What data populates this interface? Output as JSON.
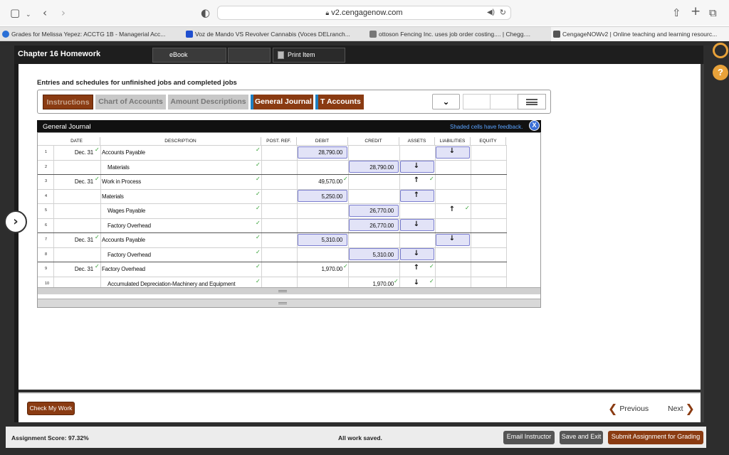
{
  "browser": {
    "url": "v2.cengagenow.com",
    "tabs": [
      {
        "label": "Grades for Melissa Yepez: ACCTG 1B - Managerial Acc...",
        "color": "#2a6fd6"
      },
      {
        "label": "Voz de Mando VS Revolver Cannabis (Voces DELranch...",
        "color": "#1f4fcf"
      },
      {
        "label": "ottoson Fencing Inc. uses job order costing.... | Chegg....",
        "color": "#777777"
      },
      {
        "label": "CengageNOWv2 | Online teaching and learning resourc...",
        "color": "#555555"
      }
    ],
    "icons": [
      "sidebar-icon",
      "back-icon",
      "forward-icon",
      "shield-icon",
      "lock-icon",
      "audio-icon",
      "reload-icon",
      "share-icon",
      "new-tab-icon",
      "tab-overview-icon"
    ]
  },
  "app": {
    "chapter_title": "Chapter 16 Homework",
    "tabs": {
      "ebook": "eBook",
      "blank": "",
      "print": "Print Item"
    },
    "heading": "Entries and schedules for unfinished jobs and completed jobs"
  },
  "toolbar": {
    "instructions": "Instructions",
    "chart_of_accounts": "Chart of Accounts",
    "amount_descriptions": "Amount Descriptions",
    "general_journal": "General Journal",
    "t_accounts": "T Accounts",
    "dropdown_icon": "chevron-down-icon",
    "menu_icon": "menu-icon"
  },
  "journal": {
    "title": "General Journal",
    "feedback_note": "Shaded cells have feedback.",
    "close_label": "X",
    "columns": {
      "date": "DATE",
      "description": "DESCRIPTION",
      "post_ref": "POST. REF.",
      "debit": "DEBIT",
      "credit": "CREDIT",
      "assets": "ASSETS",
      "liabilities": "LIABILITIES",
      "equity": "EQUITY"
    },
    "rows": [
      {
        "n": "1",
        "date": "Dec. 31",
        "desc": "Accounts Payable",
        "indent": false,
        "debit": "28,790.00",
        "credit": "",
        "assets": "",
        "liabilities": "↓"
      },
      {
        "n": "2",
        "date": "",
        "desc": "Materials",
        "indent": true,
        "debit": "",
        "credit": "28,790.00",
        "assets": "↓",
        "liabilities": ""
      },
      {
        "n": "3",
        "date": "Dec. 31",
        "desc": "Work in Process",
        "indent": false,
        "debit": "49,570.00",
        "credit": "",
        "assets": "↑",
        "liabilities": ""
      },
      {
        "n": "4",
        "date": "",
        "desc": "Materials",
        "indent": false,
        "debit": "5,250.00",
        "credit": "",
        "assets": "↑",
        "liabilities": ""
      },
      {
        "n": "5",
        "date": "",
        "desc": "Wages Payable",
        "indent": true,
        "debit": "",
        "credit": "26,770.00",
        "assets": "",
        "liabilities": "↑"
      },
      {
        "n": "6",
        "date": "",
        "desc": "Factory Overhead",
        "indent": true,
        "debit": "",
        "credit": "26,770.00",
        "assets": "↓",
        "liabilities": ""
      },
      {
        "n": "7",
        "date": "Dec. 31",
        "desc": "Accounts Payable",
        "indent": false,
        "debit": "5,310.00",
        "credit": "",
        "assets": "",
        "liabilities": "↓"
      },
      {
        "n": "8",
        "date": "",
        "desc": "Factory Overhead",
        "indent": true,
        "debit": "",
        "credit": "5,310.00",
        "assets": "↓",
        "liabilities": ""
      },
      {
        "n": "9",
        "date": "Dec. 31",
        "desc": "Factory Overhead",
        "indent": false,
        "debit": "1,970.00",
        "credit": "",
        "assets": "↑",
        "liabilities": ""
      },
      {
        "n": "10",
        "date": "",
        "desc": "Accumulated Depreciation-Machinery and Equipment",
        "indent": true,
        "debit": "",
        "credit": "1,970.00",
        "assets": "↓",
        "liabilities": ""
      }
    ]
  },
  "navigation": {
    "check_my_work": "Check My Work",
    "previous": "Previous",
    "next": "Next"
  },
  "status": {
    "score": "Assignment Score: 97.32%",
    "saved": "All work saved.",
    "email_instructor": "Email Instructor",
    "save_and_exit": "Save and Exit",
    "submit": "Submit Assignment for Grading"
  },
  "colors": {
    "accent_brown": "#8a3b12",
    "tab_blue": "#1f7fc0",
    "cell_blue": "#e2e3f7",
    "feedback_blue": "#5aa3ff"
  }
}
